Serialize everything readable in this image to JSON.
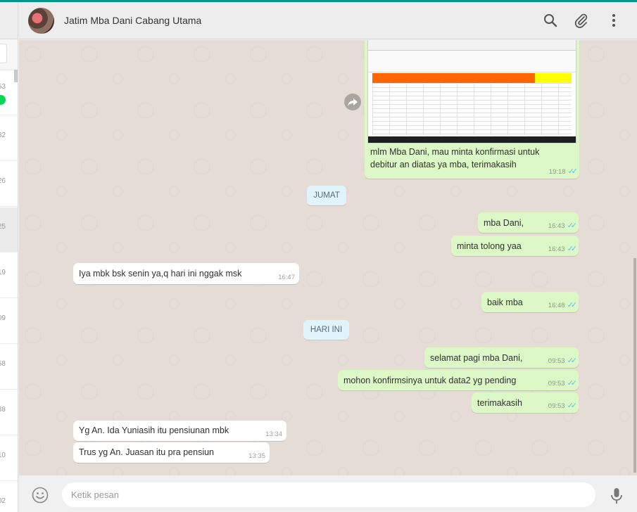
{
  "header": {
    "contact_name": "Jatim Mba Dani Cabang Utama",
    "icons": [
      "search-icon",
      "attach-icon",
      "menu-icon"
    ]
  },
  "sidebar": {
    "times": [
      "53",
      "32",
      "26",
      "25",
      "19",
      "09",
      "58",
      "38",
      "10",
      "02"
    ]
  },
  "messages": {
    "m1": {
      "text1": "mlm Mba Dani, mau minta konfirmasi untuk",
      "text2": "debitur an diatas ya mba, terimakasih",
      "time": "19:18"
    },
    "day1": "JUMAT",
    "m2": {
      "text": "mba Dani,",
      "time": "16:43"
    },
    "m3": {
      "text": "minta tolong yaa",
      "time": "16:43"
    },
    "m4": {
      "text": "Iya mbk bsk senin ya,q hari ini nggak msk",
      "time": "16:47"
    },
    "m5": {
      "text": "baik mba",
      "time": "16:48"
    },
    "day2": "HARI INI",
    "m6": {
      "text": "selamat pagi mba Dani,",
      "time": "09:53"
    },
    "m7": {
      "text": "mohon konfirmsinya untuk data2 yg pending",
      "time": "09:53"
    },
    "m8": {
      "text": "terimakasih",
      "time": "09:53"
    },
    "m9": {
      "text": "Yg An. Ida Yuniasih itu pensiunan mbk",
      "time": "13:34"
    },
    "m10": {
      "text": "Trus yg An. Juasan itu pra pensiun",
      "time": "13:35"
    }
  },
  "composer": {
    "placeholder": "Ketik pesan",
    "icons": [
      "emoji-icon",
      "microphone-icon"
    ]
  },
  "colors": {
    "outgoing_bubble": "#dcf8c6",
    "incoming_bubble": "#ffffff",
    "chat_background": "#e5ddd5",
    "read_ticks": "#4fc3f7",
    "accent": "#009688"
  }
}
